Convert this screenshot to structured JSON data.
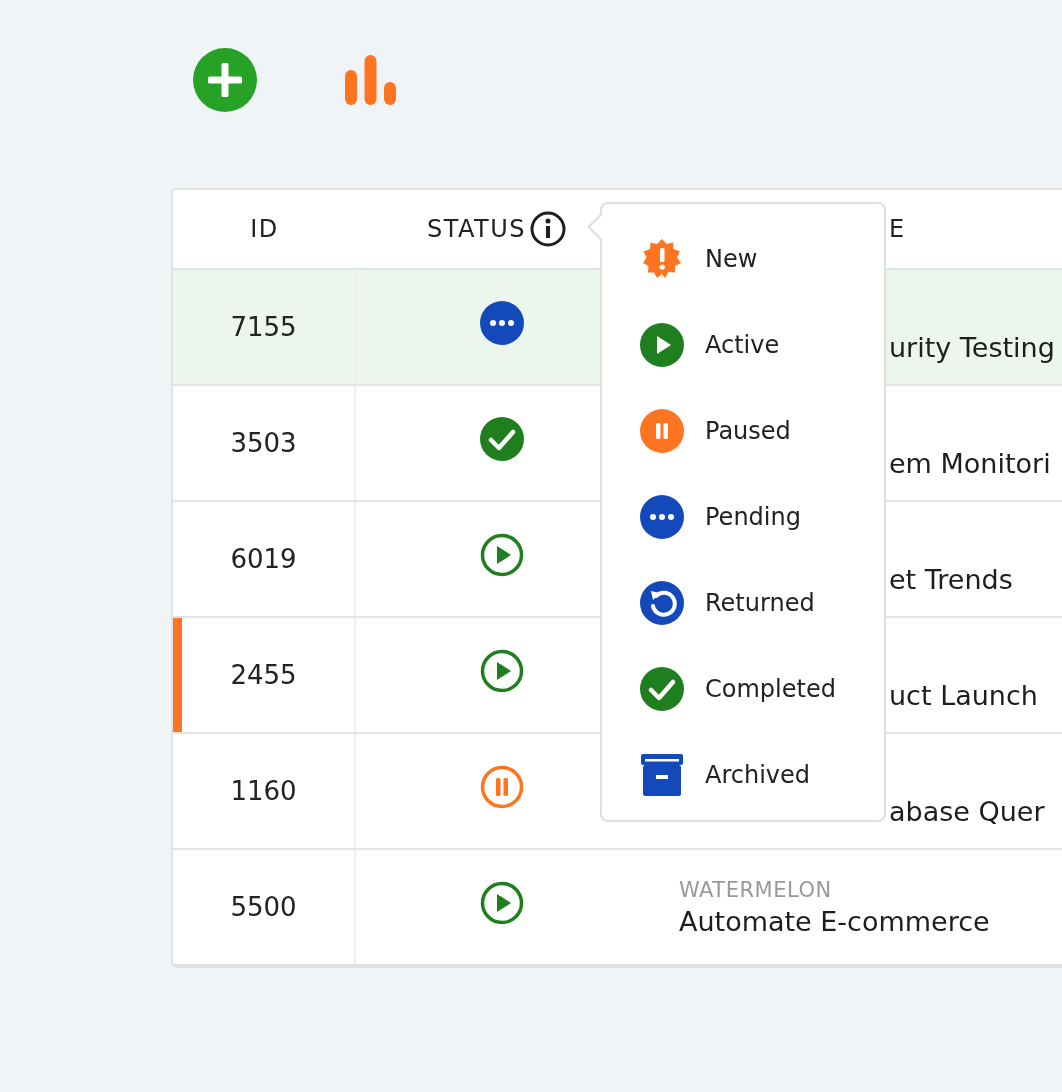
{
  "table": {
    "columns": [
      "ID",
      "STATUS",
      "E"
    ],
    "rows": [
      {
        "id": "7155",
        "kind": "pending",
        "selected": true,
        "flagged": false,
        "title": "urity Testing"
      },
      {
        "id": "3503",
        "kind": "completed",
        "selected": false,
        "flagged": false,
        "title": "em Monitori"
      },
      {
        "id": "6019",
        "kind": "active",
        "selected": false,
        "flagged": false,
        "title": "et Trends"
      },
      {
        "id": "2455",
        "kind": "active",
        "selected": false,
        "flagged": true,
        "title": "uct Launch"
      },
      {
        "id": "1160",
        "kind": "paused",
        "selected": false,
        "flagged": false,
        "title": "abase Quer"
      },
      {
        "id": "5500",
        "kind": "active",
        "selected": false,
        "flagged": false,
        "category": "WATERMELON",
        "title": "Automate E-commerce"
      }
    ]
  },
  "status_legend": [
    {
      "kind": "new",
      "label": "New"
    },
    {
      "kind": "active",
      "label": "Active"
    },
    {
      "kind": "paused",
      "label": "Paused"
    },
    {
      "kind": "pending",
      "label": "Pending"
    },
    {
      "kind": "returned",
      "label": "Returned"
    },
    {
      "kind": "completed",
      "label": "Completed"
    },
    {
      "kind": "archived",
      "label": "Archived"
    }
  ]
}
